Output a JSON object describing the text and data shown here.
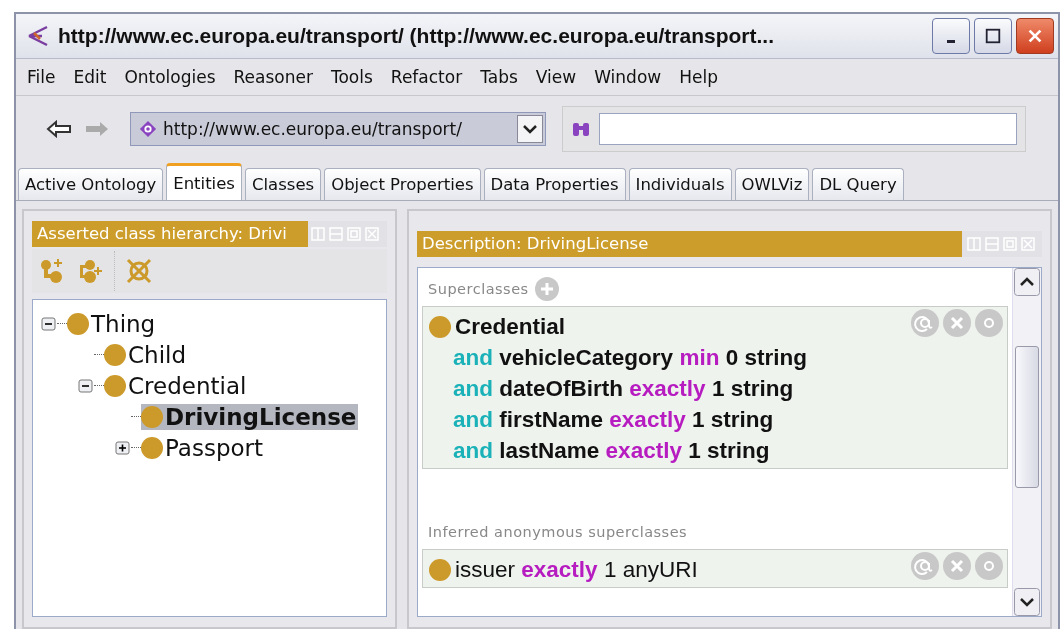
{
  "window": {
    "title": "http://www.ec.europa.eu/transport/ (http://www.ec.europa.eu/transport..."
  },
  "menu": [
    "File",
    "Edit",
    "Ontologies",
    "Reasoner",
    "Tools",
    "Refactor",
    "Tabs",
    "View",
    "Window",
    "Help"
  ],
  "toolbar": {
    "address": "http://www.ec.europa.eu/transport/"
  },
  "tabs": [
    {
      "label": "Active Ontology",
      "selected": false
    },
    {
      "label": "Entities",
      "selected": true
    },
    {
      "label": "Classes",
      "selected": false
    },
    {
      "label": "Object Properties",
      "selected": false
    },
    {
      "label": "Data Properties",
      "selected": false
    },
    {
      "label": "Individuals",
      "selected": false
    },
    {
      "label": "OWLViz",
      "selected": false
    },
    {
      "label": "DL Query",
      "selected": false
    }
  ],
  "hierarchy": {
    "title": "Asserted class hierarchy: Drivi",
    "tree": [
      {
        "label": "Thing",
        "selected": false,
        "expanded": true,
        "children": [
          {
            "label": "Child",
            "selected": false
          },
          {
            "label": "Credential",
            "selected": false,
            "expanded": true,
            "children": [
              {
                "label": "DrivingLicense",
                "selected": true
              },
              {
                "label": "Passport",
                "selected": false,
                "expanded": false
              }
            ]
          }
        ]
      }
    ]
  },
  "description": {
    "title": "Description: DrivingLicense",
    "sections": [
      {
        "heading": "Superclasses",
        "inferred": false,
        "frames": [
          [
            [
              {
                "t": "Credential",
                "kind": "plain"
              }
            ],
            [
              {
                "t": "and",
                "kind": "keyword"
              },
              {
                "t": "vehicleCategory",
                "kind": "plain"
              },
              {
                "t": "min",
                "kind": "restriction"
              },
              {
                "t": "0 string",
                "kind": "plain"
              }
            ],
            [
              {
                "t": "and",
                "kind": "keyword"
              },
              {
                "t": "dateOfBirth",
                "kind": "plain"
              },
              {
                "t": "exactly",
                "kind": "restriction"
              },
              {
                "t": "1 string",
                "kind": "plain"
              }
            ],
            [
              {
                "t": "and",
                "kind": "keyword"
              },
              {
                "t": "firstName",
                "kind": "plain"
              },
              {
                "t": "exactly",
                "kind": "restriction"
              },
              {
                "t": "1 string",
                "kind": "plain"
              }
            ],
            [
              {
                "t": "and",
                "kind": "keyword"
              },
              {
                "t": "lastName",
                "kind": "plain"
              },
              {
                "t": "exactly",
                "kind": "restriction"
              },
              {
                "t": "1 string",
                "kind": "plain"
              }
            ]
          ]
        ]
      },
      {
        "heading": "Inferred anonymous superclasses",
        "inferred": true,
        "frames": [
          [
            [
              {
                "t": "issuer",
                "kind": "plain"
              },
              {
                "t": "exactly",
                "kind": "restriction"
              },
              {
                "t": "1 anyURI",
                "kind": "plain"
              }
            ]
          ]
        ]
      }
    ]
  }
}
